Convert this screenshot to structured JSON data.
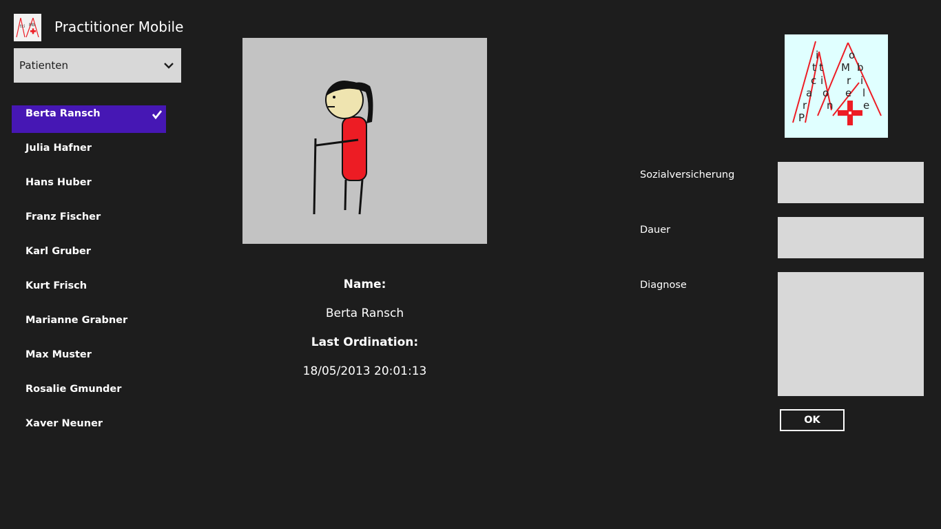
{
  "app": {
    "title": "Practitioner Mobile",
    "logo_icon": "practitioner-mobile-logo-icon"
  },
  "dropdown": {
    "selected": "Patienten",
    "icon": "chevron-down-icon"
  },
  "patients": [
    {
      "name": "Berta Ransch",
      "selected": true
    },
    {
      "name": "Julia Hafner",
      "selected": false
    },
    {
      "name": "Hans Huber",
      "selected": false
    },
    {
      "name": "Franz Fischer",
      "selected": false
    },
    {
      "name": "Karl Gruber",
      "selected": false
    },
    {
      "name": "Kurt Frisch",
      "selected": false
    },
    {
      "name": "Marianne Grabner",
      "selected": false
    },
    {
      "name": "Max Muster",
      "selected": false
    },
    {
      "name": "Rosalie Gmunder",
      "selected": false
    },
    {
      "name": "Xaver Neuner",
      "selected": false
    }
  ],
  "details": {
    "name_label": "Name:",
    "name_value": "Berta Ransch",
    "ordination_label": "Last Ordination:",
    "ordination_value": "18/05/2013 20:01:13"
  },
  "brand_logo": {
    "letters_left": [
      "i",
      "t",
      "t",
      "c",
      "i",
      "a",
      "r",
      "P"
    ],
    "letters_middle": [
      "o",
      "n",
      "e"
    ],
    "letters_right": [
      "o",
      "M",
      "b",
      "r",
      "i",
      "l",
      "e"
    ]
  },
  "form": {
    "social_label": "Sozialversicherung",
    "social_value": "",
    "duration_label": "Dauer",
    "duration_value": "",
    "diagnosis_label": "Diagnose",
    "diagnosis_value": "",
    "ok_label": "OK"
  },
  "colors": {
    "background": "#1d1d1d",
    "selection": "#4617b4",
    "input": "#d8d8d8",
    "accent_red": "#ed1c24"
  }
}
